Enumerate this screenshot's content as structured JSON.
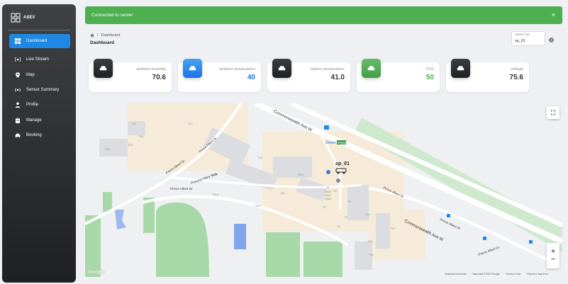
{
  "brand": {
    "name": "ASEV"
  },
  "nav": [
    {
      "label": "Dashboard",
      "icon": "grid-icon",
      "active": true
    },
    {
      "label": "Live Stream",
      "icon": "broadcast-icon"
    },
    {
      "label": "Map",
      "icon": "pin-icon"
    },
    {
      "label": "Sensor Summary",
      "icon": "sensor-icon"
    },
    {
      "label": "Profile",
      "icon": "person-icon"
    },
    {
      "label": "Manage",
      "icon": "clipboard-icon"
    },
    {
      "label": "Booking",
      "icon": "car-icon"
    }
  ],
  "alert": {
    "text": "Connected to server",
    "close": "×"
  },
  "breadcrumb": {
    "current": "Dashboard"
  },
  "page_title": "Dashboard",
  "select_car": {
    "label": "Select Car",
    "value": "sp_01"
  },
  "cards": [
    {
      "label": "ambient humidity",
      "value": "70.6",
      "icon": "car-icon",
      "color": "#262626"
    },
    {
      "label": "ambient temperature",
      "value": "40",
      "icon": "car-icon",
      "color": "#1a73e8"
    },
    {
      "label": "battery temperature",
      "value": "41.0",
      "icon": "car-icon",
      "color": "#262626"
    },
    {
      "label": "CO2",
      "value": "50",
      "icon": "car-icon",
      "color": "#4caf50"
    },
    {
      "label": "voltage",
      "value": "75.6",
      "icon": "car-icon",
      "color": "#262626"
    }
  ],
  "map": {
    "roads": [
      "Commonwealth Ave W",
      "Commonwealth Ave W",
      "Prince Albert Dr",
      "Prince Albert Dr",
      "Prince Albert Dr",
      "Princess Mary Walk",
      "Prince Albert Dr",
      "Prince Albert Dr",
      "Prince Albert Dr"
    ],
    "buildings": [
      "T21",
      "T17",
      "T15",
      "T14",
      "T18",
      "T24",
      "W12",
      "W13",
      "W14",
      "T11",
      "W12",
      "T9",
      "T14",
      "T13",
      "T12",
      "T11",
      "T8",
      "T7",
      "T5",
      "T4",
      "T3",
      "T3A/B",
      "T3A/C",
      "T3A/D"
    ],
    "station": "Dover",
    "station_badge": "EW22",
    "vehicle_label": "sp_01",
    "google": "Google",
    "attribution": [
      "Keyboard shortcuts",
      "Map data ©2022 Google",
      "Terms of Use",
      "Report a map error"
    ],
    "zoom_in": "+",
    "zoom_out": "−"
  }
}
